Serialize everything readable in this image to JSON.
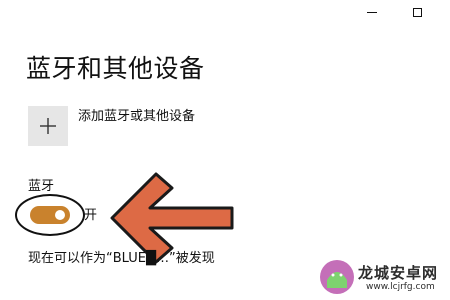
{
  "window_controls": {
    "icons": [
      "minimize-icon",
      "maximize-icon"
    ]
  },
  "page": {
    "title": "蓝牙和其他设备"
  },
  "add_device": {
    "icon": "plus-icon",
    "label": "添加蓝牙或其他设备"
  },
  "bluetooth": {
    "section_label": "蓝牙",
    "toggle_on": true,
    "toggle_state_label": "开",
    "accent_color": "#c9822d",
    "discoverable_text": "现在可以作为“BLUE█…”被发现"
  },
  "annotation": {
    "arrow_color": "#dd6a45",
    "arrow_icon": "left-arrow-annotation"
  },
  "watermark": {
    "brand": "龙城安卓网",
    "url": "www.lcjrfg.com"
  }
}
